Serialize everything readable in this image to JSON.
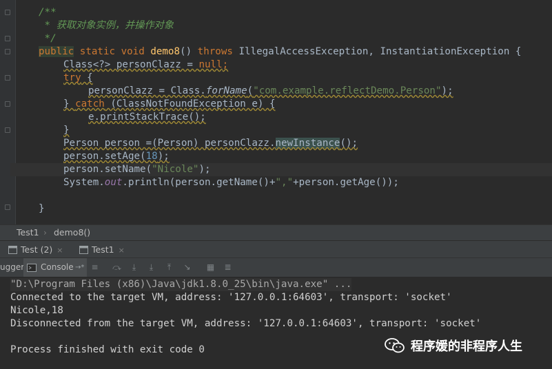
{
  "editor": {
    "lines": {
      "l1": "/**",
      "l2": " * 获取对象实例，并操作对象",
      "l3": " */",
      "l4": {
        "public": "public",
        "static": "static",
        "void": "void",
        "method": "demo8",
        "params": "()",
        "throws": "throws",
        "exceptions": "IllegalAccessException, InstantiationException {"
      },
      "l5": {
        "type": "Class<?> personClazz = ",
        "null": "null",
        "semi": ";"
      },
      "l6": {
        "try": "try",
        "brace": " {"
      },
      "l7": {
        "pre": "personClazz = Class.",
        "call": "forName",
        "open": "(",
        "str": "\"com.example.reflectDemo.Person\"",
        "close": ");"
      },
      "l8": {
        "brace": "} ",
        "catch": "catch",
        "rest": " (ClassNotFoundException e) {"
      },
      "l9": "e.printStackTrace();",
      "l10": "}",
      "l11": {
        "pre": "Person person =(Person) personClazz.",
        "call": "newInstance",
        "post": "();"
      },
      "l12": {
        "pre": "person.setAge(",
        "num": "18",
        "post": ");"
      },
      "l13": {
        "pre": "person.setName(",
        "str": "\"Nicole\"",
        "post": ");"
      },
      "l14": {
        "pre": "System.",
        "out": "out",
        "post": ".println(person.getName()+",
        "str": "\",\"",
        "post2": "+person.getAge());"
      },
      "l16": "}"
    }
  },
  "breadcrumb": {
    "class": "Test1",
    "sep": "›",
    "method": "demo8()"
  },
  "run_tabs": [
    {
      "label": "Test (2)",
      "close": "×"
    },
    {
      "label": "Test1",
      "close": "×"
    }
  ],
  "toolbar": {
    "debugger_label": "ugger",
    "console_label": "Console",
    "console_suffix": "→*"
  },
  "console": {
    "cmd": "\"D:\\Program Files (x86)\\Java\\jdk1.8.0_25\\bin\\java.exe\" ...",
    "connected": "Connected to the target VM, address: '127.0.0.1:64603', transport: 'socket'",
    "output": "Nicole,18",
    "disconnected": "Disconnected from the target VM, address: '127.0.0.1:64603', transport: 'socket'",
    "exit": "Process finished with exit code 0"
  },
  "watermark": {
    "text": "程序媛的非程序人生",
    "icon": "wechat-icon"
  },
  "colors": {
    "background": "#2b2b2b",
    "keyword": "#cc7832",
    "string": "#6a8759",
    "number": "#6897bb",
    "method": "#ffc66d",
    "comment": "#629755",
    "text": "#a9b7c6"
  }
}
